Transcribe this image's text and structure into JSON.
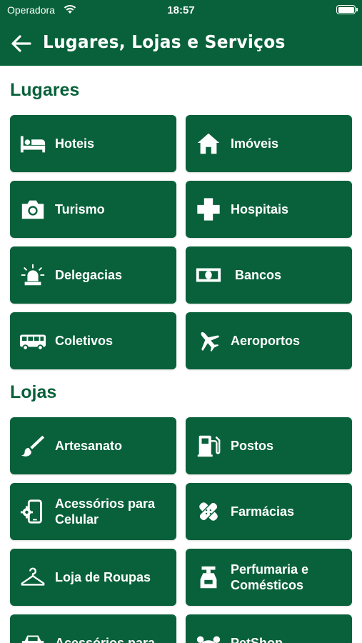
{
  "status": {
    "carrier": "Operadora",
    "time": "18:57"
  },
  "header": {
    "title": "Lugares, Lojas e Serviços"
  },
  "sections": [
    {
      "title": "Lugares",
      "items": [
        {
          "label": "Hoteis",
          "icon": "bed-icon"
        },
        {
          "label": "Imóveis",
          "icon": "house-icon"
        },
        {
          "label": "Turismo",
          "icon": "camera-icon"
        },
        {
          "label": "Hospitais",
          "icon": "medical-cross-icon"
        },
        {
          "label": "Delegacias",
          "icon": "police-siren-icon"
        },
        {
          "label": "Bancos",
          "icon": "money-bill-icon"
        },
        {
          "label": "Coletivos",
          "icon": "bus-icon"
        },
        {
          "label": "Aeroportos",
          "icon": "airplane-icon"
        }
      ]
    },
    {
      "title": "Lojas",
      "items": [
        {
          "label": "Artesanato",
          "icon": "paintbrush-icon"
        },
        {
          "label": "Postos",
          "icon": "gas-pump-icon"
        },
        {
          "label": "Acessórios para Celular",
          "icon": "phone-settings-icon"
        },
        {
          "label": "Farmácias",
          "icon": "bandage-icon"
        },
        {
          "label": "Loja de Roupas",
          "icon": "hanger-icon"
        },
        {
          "label": "Perfumaria e Comésticos",
          "icon": "perfume-bottle-icon"
        },
        {
          "label": "Acessórios para",
          "icon": "car-icon"
        },
        {
          "label": "PetShop",
          "icon": "pet-icon"
        }
      ]
    }
  ],
  "colors": {
    "primary": "#08613a",
    "background": "#ffffff",
    "text_on_primary": "#ffffff"
  }
}
